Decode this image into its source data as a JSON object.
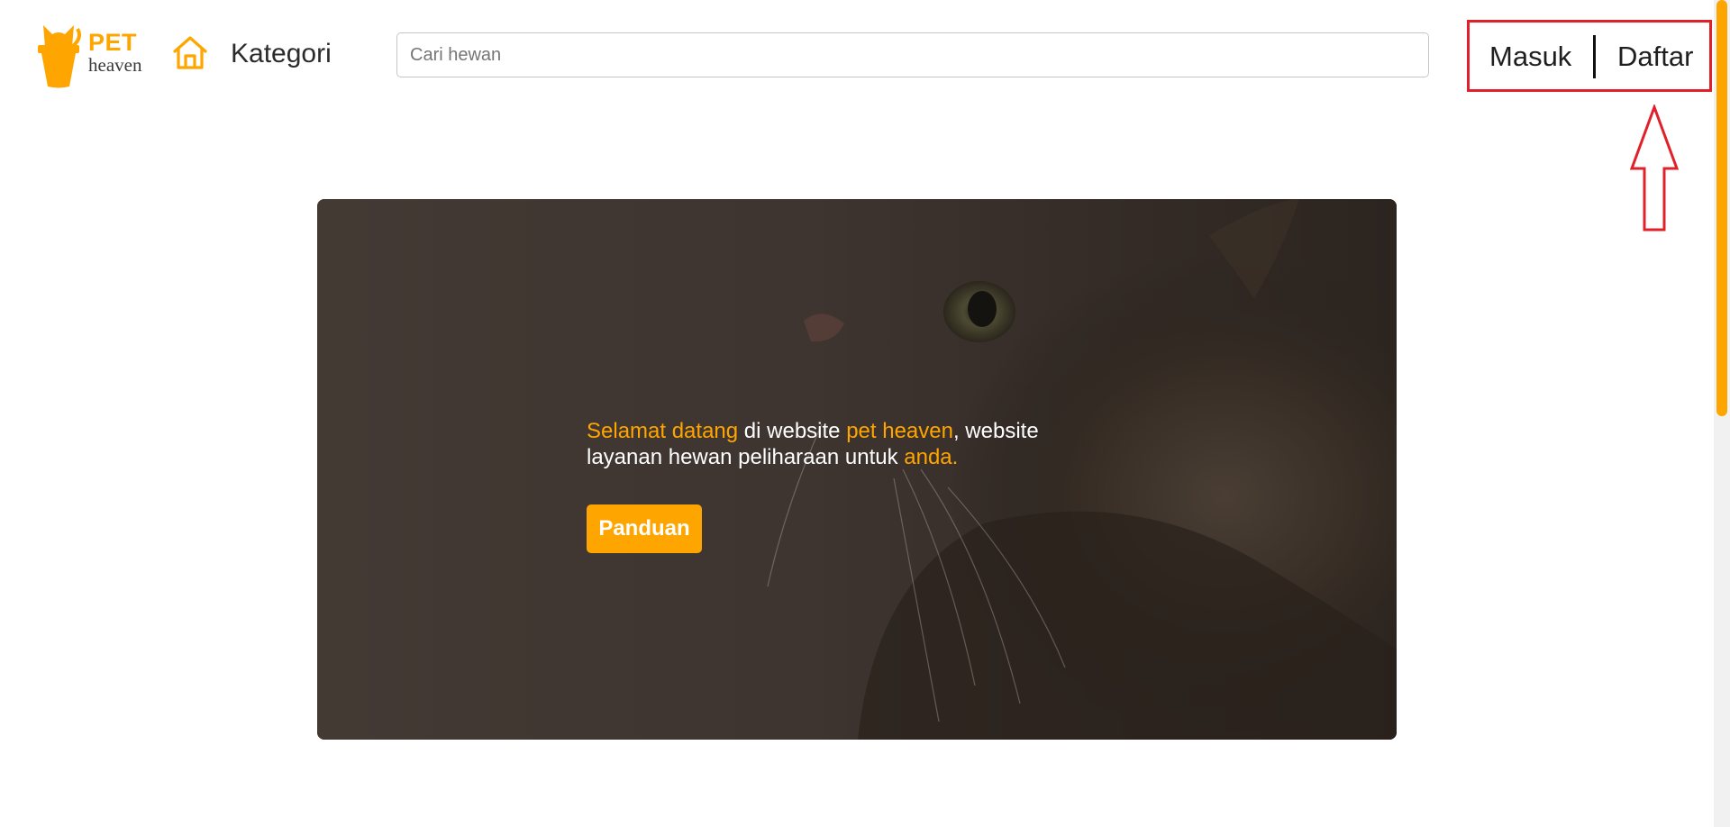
{
  "header": {
    "logo": {
      "word_top": "PET",
      "word_bottom": "heaven",
      "icon": "cat-pot-logo"
    },
    "home_icon": "home-icon",
    "kategori_label": "Kategori",
    "search": {
      "placeholder": "Cari hewan",
      "value": ""
    },
    "auth": {
      "login_label": "Masuk",
      "register_label": "Daftar"
    }
  },
  "annotation": {
    "icon": "up-arrow-annotation",
    "color": "#e0202a"
  },
  "hero": {
    "text_parts": [
      {
        "text": "Selamat datang",
        "highlight": true
      },
      {
        "text": " di website ",
        "highlight": false
      },
      {
        "text": "pet heaven",
        "highlight": true
      },
      {
        "text": ", website layanan hewan peliharaan untuk ",
        "highlight": false
      },
      {
        "text": "anda.",
        "highlight": true
      }
    ],
    "button_label": "Panduan"
  },
  "colors": {
    "accent": "#ffa500",
    "annotation": "#e0202a",
    "text_dark": "#1f1f1f",
    "hero_overlay": "#3d3430"
  }
}
